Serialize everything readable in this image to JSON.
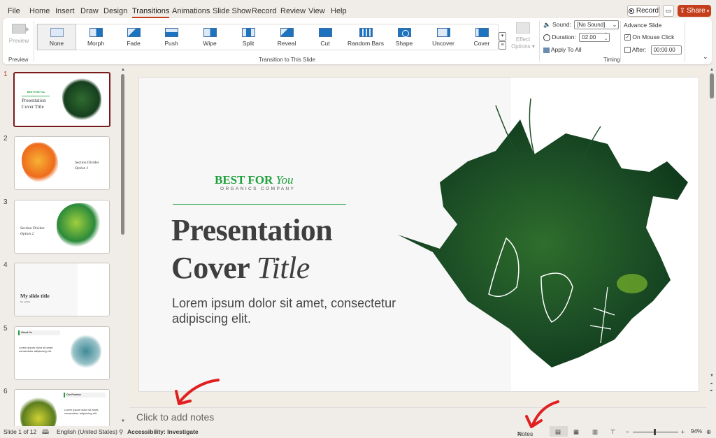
{
  "menu": {
    "tabs": [
      "File",
      "Home",
      "Insert",
      "Draw",
      "Design",
      "Transitions",
      "Animations",
      "Slide Show",
      "Record",
      "Review",
      "View",
      "Help"
    ],
    "active_tab": "Transitions",
    "record_label": "Record",
    "share_label": "Share"
  },
  "ribbon": {
    "preview": {
      "button_label": "Preview",
      "group_label": "Preview"
    },
    "transitions": {
      "group_label": "Transition to This Slide",
      "items": [
        "None",
        "Morph",
        "Fade",
        "Push",
        "Wipe",
        "Split",
        "Reveal",
        "Cut",
        "Random Bars",
        "Shape",
        "Uncover",
        "Cover"
      ],
      "selected": "None"
    },
    "effect_options_label": "Effect Options",
    "timing": {
      "group_label": "Timing",
      "sound_label": "Sound:",
      "sound_value": "[No Sound]",
      "duration_label": "Duration:",
      "duration_value": "02.00",
      "apply_all_label": "Apply To All",
      "advance_label": "Advance Slide",
      "on_mouse_click_label": "On Mouse Click",
      "on_mouse_click_checked": true,
      "after_label": "After:",
      "after_checked": false,
      "after_value": "00:00.00"
    }
  },
  "thumbnails": [
    {
      "num": "1",
      "title": "Presentation Cover Title",
      "brand": "BEST FOR You",
      "selected": true
    },
    {
      "num": "2",
      "title": "Section Divider",
      "subtitle": "Option 1"
    },
    {
      "num": "3",
      "title": "Section Divider",
      "subtitle": "Option 2"
    },
    {
      "num": "4",
      "title": "My slide title",
      "subtitle": "My subtitle"
    },
    {
      "num": "5",
      "title": "About Us",
      "body": "Lorem ipsum dolor sit amet, consectetur adipiscing elit."
    },
    {
      "num": "6",
      "title": "Our Promise",
      "body": "Lorem ipsum dolor sit amet, consectetur adipiscing elit."
    }
  ],
  "slide": {
    "brand_main": "BEST FOR ",
    "brand_italic": "You",
    "brand_sub": "ORGANICS COMPANY",
    "title_line1": "Presentation",
    "title_line2_bold": "Cover ",
    "title_line2_italic": "Title",
    "body": "Lorem ipsum dolor sit amet, consectetur adipiscing elit."
  },
  "notes": {
    "placeholder": "Click to add notes"
  },
  "status": {
    "slide_counter": "Slide 1 of 12",
    "language": "English (United States)",
    "accessibility": "Accessibility: Investigate",
    "notes_label": "Notes",
    "zoom": "94%",
    "zoom_fraction": 0.47
  },
  "colors": {
    "accent": "#c43e1c",
    "brand_green": "#1fa03d",
    "selected_thumb": "#7a1a1a",
    "annotation_arrow": "#e02020"
  }
}
